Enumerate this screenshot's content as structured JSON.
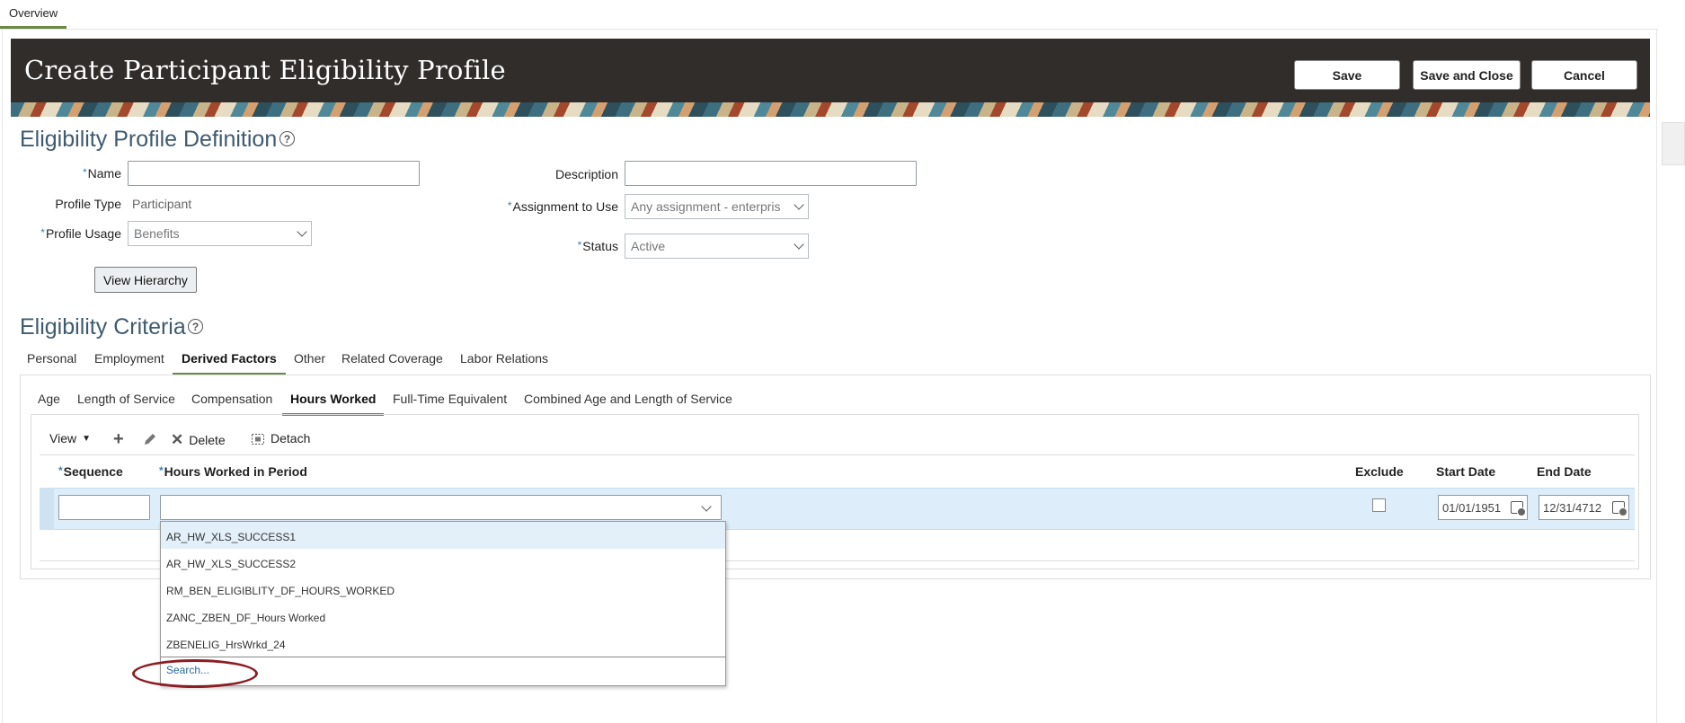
{
  "top_tab": "Overview",
  "header": {
    "title": "Create Participant Eligibility Profile",
    "save": "Save",
    "save_close": "Save and Close",
    "cancel": "Cancel"
  },
  "definition": {
    "title": "Eligibility Profile Definition",
    "name_label": "Name",
    "name_value": "",
    "profile_type_label": "Profile Type",
    "profile_type_value": "Participant",
    "profile_usage_label": "Profile Usage",
    "profile_usage_value": "Benefits",
    "view_hierarchy": "View Hierarchy",
    "description_label": "Description",
    "description_value": "",
    "assignment_label": "Assignment to Use",
    "assignment_value": "Any assignment - enterpris",
    "status_label": "Status",
    "status_value": "Active"
  },
  "criteria": {
    "title": "Eligibility Criteria",
    "tabs": [
      "Personal",
      "Employment",
      "Derived Factors",
      "Other",
      "Related Coverage",
      "Labor Relations"
    ],
    "subtabs": [
      "Age",
      "Length of Service",
      "Compensation",
      "Hours Worked",
      "Full-Time Equivalent",
      "Combined Age and Length of Service"
    ]
  },
  "toolbar": {
    "view": "View",
    "delete": "Delete",
    "detach": "Detach"
  },
  "table": {
    "headers": {
      "sequence": "Sequence",
      "hours": "Hours Worked in Period",
      "exclude": "Exclude",
      "start": "Start Date",
      "end": "End Date"
    },
    "row": {
      "sequence": "",
      "hours": "",
      "start_date": "01/01/1951",
      "end_date": "12/31/4712"
    }
  },
  "dropdown": {
    "options": [
      "AR_HW_XLS_SUCCESS1",
      "AR_HW_XLS_SUCCESS2",
      "RM_BEN_ELIGIBLITY_DF_HOURS_WORKED",
      "ZANC_ZBEN_DF_Hours Worked",
      "ZBENELIG_HrsWrkd_24"
    ],
    "search": "Search..."
  },
  "colors": {
    "banner": "#312d2a",
    "accent": "#6a8a46",
    "section_title": "#3f5a6e",
    "highlight_row": "#ddeefa",
    "annotation_oval": "#8b1d23"
  }
}
